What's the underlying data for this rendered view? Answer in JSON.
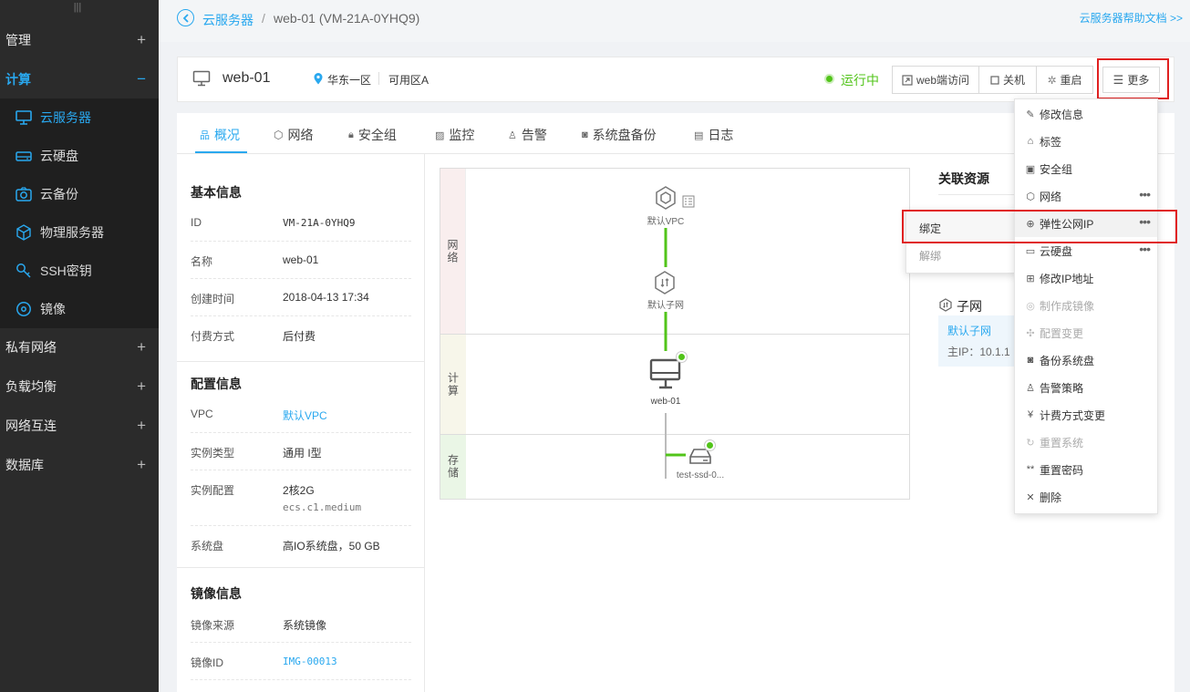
{
  "sidebar": {
    "groups": [
      {
        "label": "管理",
        "sign": "+"
      },
      {
        "label": "计算",
        "sign": "−"
      },
      {
        "label": "私有网络",
        "sign": "+"
      },
      {
        "label": "负载均衡",
        "sign": "+"
      },
      {
        "label": "网络互连",
        "sign": "+"
      },
      {
        "label": "数据库",
        "sign": "+"
      }
    ],
    "compute_items": [
      {
        "label": "云服务器",
        "icon": "monitor-icon"
      },
      {
        "label": "云硬盘",
        "icon": "disk-icon"
      },
      {
        "label": "云备份",
        "icon": "camera-icon"
      },
      {
        "label": "物理服务器",
        "icon": "cube-icon"
      },
      {
        "label": "SSH密钥",
        "icon": "key-icon"
      },
      {
        "label": "镜像",
        "icon": "disc-icon"
      }
    ]
  },
  "breadcrumb": {
    "parent": "云服务器",
    "sep": "/",
    "current": "web-01",
    "current_id": "(VM-21A-0YHQ9)"
  },
  "help_link": "云服务器帮助文档 >>",
  "instance": {
    "name": "web-01",
    "region": "华东一区",
    "zone": "可用区A",
    "status": "运行中",
    "status_color": "#52c41a"
  },
  "actions": {
    "web_access": "web端访问",
    "shutdown": "关机",
    "restart": "重启",
    "more": "更多"
  },
  "tabs": [
    "概况",
    "网络",
    "安全组",
    "监控",
    "告警",
    "系统盘备份",
    "日志"
  ],
  "basic": {
    "title": "基本信息",
    "rows": [
      {
        "label": "ID",
        "value": "VM-21A-0YHQ9"
      },
      {
        "label": "名称",
        "value": "web-01"
      },
      {
        "label": "创建时间",
        "value": "2018-04-13 17:34"
      },
      {
        "label": "付费方式",
        "value": "后付费"
      }
    ]
  },
  "config": {
    "title": "配置信息",
    "vpc_label": "VPC",
    "vpc_value": "默认VPC",
    "type_label": "实例类型",
    "type_value": "通用 I型",
    "spec_label": "实例配置",
    "spec_value": "2核2G",
    "spec_sub": "ecs.c1.medium",
    "disk_label": "系统盘",
    "disk_value": "高IO系统盘，50 GB"
  },
  "image": {
    "title": "镜像信息",
    "source_label": "镜像来源",
    "source_value": "系统镜像",
    "id_label": "镜像ID",
    "id_value": "IMG-00013"
  },
  "topology": {
    "zones": [
      "网络",
      "计算",
      "存储"
    ],
    "vpc": "默认VPC",
    "subnet": "默认子网",
    "server": "web-01",
    "disk": "test-ssd-0...",
    "line_color": "#52c41a"
  },
  "related": {
    "title": "关联资源",
    "subnet_title": "子网",
    "subnet_link": "默认子网",
    "main_ip": "主IP：10.1.1"
  },
  "more_menu": [
    {
      "label": "修改信息",
      "icon": "✎",
      "disabled": false,
      "sub": false
    },
    {
      "label": "标签",
      "icon": "⌂",
      "disabled": false,
      "sub": false
    },
    {
      "label": "安全组",
      "icon": "▣",
      "disabled": false,
      "sub": false
    },
    {
      "label": "网络",
      "icon": "⬡",
      "disabled": false,
      "sub": true
    },
    {
      "label": "弹性公网IP",
      "icon": "⊕",
      "disabled": false,
      "sub": true
    },
    {
      "label": "云硬盘",
      "icon": "▭",
      "disabled": false,
      "sub": true
    },
    {
      "label": "修改IP地址",
      "icon": "⊞",
      "disabled": false,
      "sub": false
    },
    {
      "label": "制作成镜像",
      "icon": "◎",
      "disabled": true,
      "sub": false
    },
    {
      "label": "配置变更",
      "icon": "✣",
      "disabled": true,
      "sub": false
    },
    {
      "label": "备份系统盘",
      "icon": "◙",
      "disabled": false,
      "sub": false
    },
    {
      "label": "告警策略",
      "icon": "♙",
      "disabled": false,
      "sub": false
    },
    {
      "label": "计费方式变更",
      "icon": "¥",
      "disabled": false,
      "sub": false
    },
    {
      "label": "重置系统",
      "icon": "↻",
      "disabled": true,
      "sub": false
    },
    {
      "label": "重置密码",
      "icon": "**",
      "disabled": false,
      "sub": false
    },
    {
      "label": "删除",
      "icon": "✕",
      "disabled": false,
      "sub": false
    }
  ],
  "eip_submenu": [
    "绑定",
    "解绑"
  ],
  "dots": "•••",
  "highlight_color": "#e02020"
}
